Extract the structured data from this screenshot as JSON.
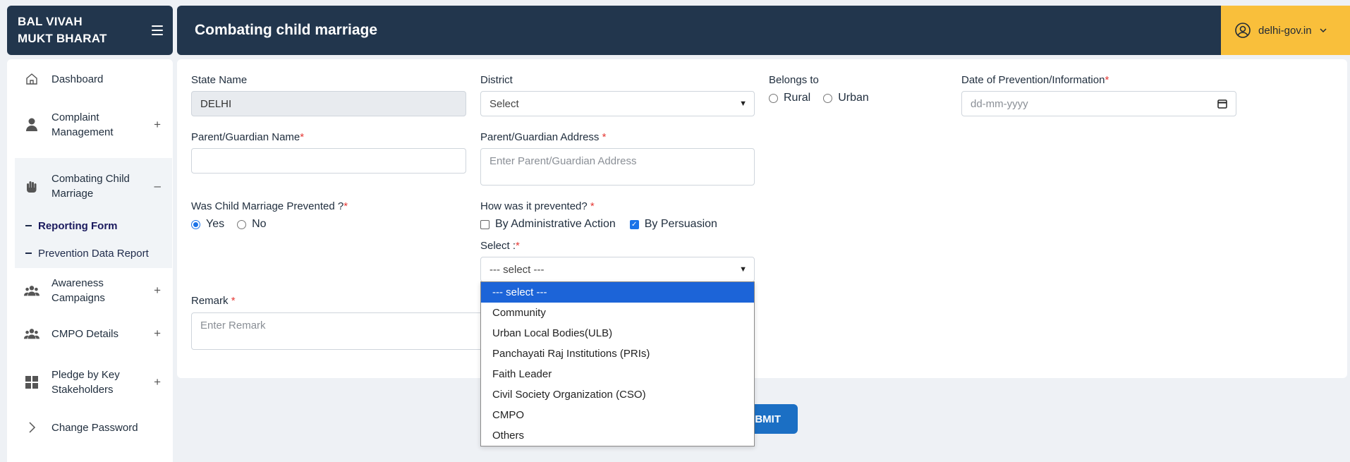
{
  "brand": {
    "line1": "BAL VIVAH",
    "line2": "MUKT BHARAT"
  },
  "header": {
    "title": "Combating child marriage",
    "user": "delhi-gov.in"
  },
  "sidebar": {
    "items": [
      {
        "label": "Dashboard",
        "icon": "home-icon"
      },
      {
        "label": "Complaint Management",
        "icon": "user-icon",
        "toggle": "+"
      },
      {
        "label": "Combating Child Marriage",
        "icon": "hand-icon",
        "toggle": "–"
      },
      {
        "label": "Awareness Campaigns",
        "icon": "users-icon",
        "toggle": "+"
      },
      {
        "label": "CMPO Details",
        "icon": "users-icon",
        "toggle": "+"
      },
      {
        "label": "Pledge by Key Stakeholders",
        "icon": "grid-icon",
        "toggle": "+"
      },
      {
        "label": "Change Password",
        "icon": "chevron-right-icon"
      }
    ],
    "subitems": [
      {
        "label": "Reporting Form"
      },
      {
        "label": "Prevention Data Report"
      }
    ]
  },
  "form": {
    "state_label": "State Name",
    "state_value": "DELHI",
    "district_label": "District",
    "district_value": "Select",
    "belongs_label": "Belongs to",
    "belongs_rural": "Rural",
    "belongs_urban": "Urban",
    "date_label": "Date of Prevention/Information",
    "date_placeholder": "dd-mm-yyyy",
    "parent_name_label": "Parent/Guardian Name",
    "parent_address_label": "Parent/Guardian Address ",
    "parent_address_placeholder": "Enter Parent/Guardian Address",
    "prevented_label": "Was Child Marriage Prevented ?",
    "prevented_yes": "Yes",
    "prevented_no": "No",
    "how_label": "How was it prevented? ",
    "how_admin": "By Administrative Action",
    "how_persuasion": "By Persuasion",
    "select_label": "Select :",
    "select_value": "--- select ---",
    "remark_label": "Remark ",
    "remark_placeholder": "Enter Remark",
    "required_mark": "*"
  },
  "submit_label": "UBMIT",
  "dropdown": {
    "options": [
      "--- select ---",
      "Community",
      "Urban Local Bodies(ULB)",
      "Panchayati Raj Institutions (PRIs)",
      "Faith Leader",
      "Civil Society Organization (CSO)",
      "CMPO",
      "Others"
    ],
    "selected_index": 0
  },
  "colors": {
    "navy": "#22364d",
    "accent": "#f9bf3b",
    "primary": "#1b6fc4"
  }
}
